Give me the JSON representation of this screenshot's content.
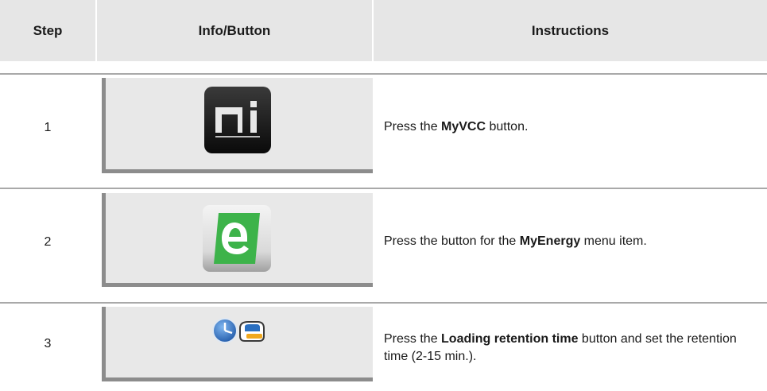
{
  "header": {
    "step": "Step",
    "info": "Info/Button",
    "instructions": "Instructions"
  },
  "rows": [
    {
      "step": "1",
      "icon": "myvcc-icon",
      "instruction_pre": "Press the ",
      "instruction_bold": "MyVCC",
      "instruction_post": " button."
    },
    {
      "step": "2",
      "icon": "myenergy-e-icon",
      "instruction_pre": "Press the button for the ",
      "instruction_bold": "MyEnergy",
      "instruction_post": " menu item."
    },
    {
      "step": "3",
      "icon": "loading-retention-time-icon",
      "instruction_pre": "Press the ",
      "instruction_bold": "Loading retention time",
      "instruction_post": " button and set the retention time (2-15 min.)."
    }
  ],
  "colors": {
    "header_bg": "#e6e6e6",
    "panel_bg": "#e8e8e8",
    "panel_border": "#8c8c8c",
    "energy_green": "#3db34a",
    "clock_blue": "#2a6fc0"
  }
}
